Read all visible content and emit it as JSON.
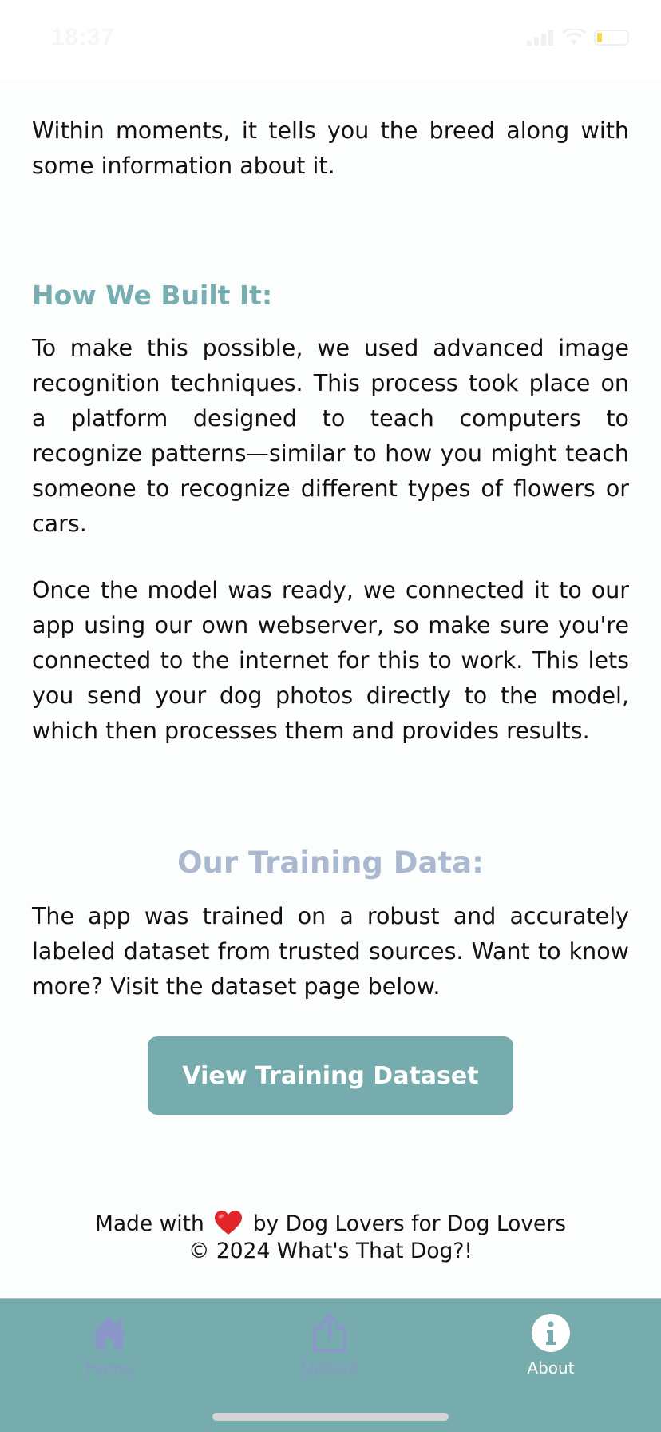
{
  "status_bar": {
    "time": "18:37"
  },
  "about": {
    "intro_tail": "Within moments, it tells you the breed along with some information about it.",
    "how_heading": "How We Built It:",
    "how_para1": "To make this possible, we used advanced image recognition techniques. This process took place on a platform designed to teach computers to recognize patterns—similar to how you might teach someone to recognize different types of flowers or cars.",
    "how_para2": "Once the model was ready, we connected it to our app using our own webserver, so make sure you're connected to the internet for this to work. This lets you send your dog photos directly to the model, which then processes them and provides results.",
    "training_heading": "Our Training Data:",
    "training_para": "The app was trained on a robust and accurately labeled dataset from trusted sources. Want to know more? Visit the dataset page below.",
    "dataset_button_label": "View Training Dataset"
  },
  "footer": {
    "made_with_prefix": "Made with",
    "heart_icon": "red-heart-emoji",
    "made_with_suffix": "by Dog Lovers for Dog Lovers",
    "copyright": "© 2024 What's That Dog?!"
  },
  "tab_bar": {
    "tabs": [
      {
        "label": "Home",
        "icon": "home-icon",
        "active": false
      },
      {
        "label": "Upload",
        "icon": "upload-icon",
        "active": false
      },
      {
        "label": "About",
        "icon": "info-icon",
        "active": true
      }
    ]
  },
  "colors": {
    "accent": "#76acad",
    "heading_teal": "#77aeb1",
    "heading_blue": "#aab8d0",
    "inactive_tab": "#8b97c8",
    "heart": "#e0262b",
    "battery": "#f6d64a"
  }
}
